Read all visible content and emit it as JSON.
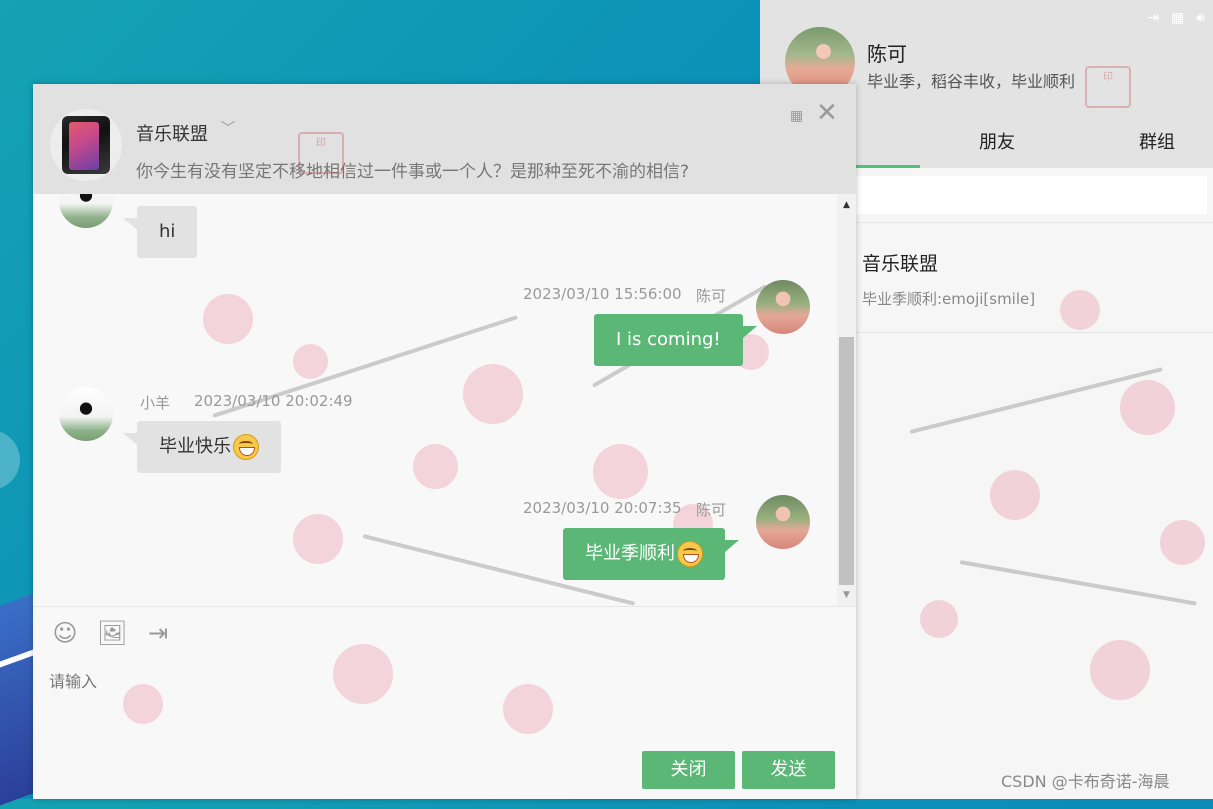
{
  "main_panel": {
    "user_name": "陈可",
    "signature": "毕业季，稻谷丰收，毕业顺利",
    "tabs": [
      {
        "label": "朋友"
      },
      {
        "label": "群组"
      }
    ],
    "conversation": {
      "name": "音乐联盟",
      "last_message": "毕业季顺利:emoji[smile]"
    }
  },
  "chat": {
    "group_name": "音乐联盟",
    "group_desc": "你今生有没有坚定不移地相信过一件事或一个人？是那种至死不渝的相信?",
    "messages": [
      {
        "direction": "in",
        "sender": "",
        "time": "",
        "text": "hi"
      },
      {
        "direction": "out",
        "sender": "陈可",
        "time": "2023/03/10 15:56:00",
        "text": "I is coming!"
      },
      {
        "direction": "in",
        "sender": "小羊",
        "time": "2023/03/10 20:02:49",
        "text": "毕业快乐",
        "emoji": "grin"
      },
      {
        "direction": "out",
        "sender": "陈可",
        "time": "2023/03/10 20:07:35",
        "text": "毕业季顺利",
        "emoji": "grin"
      }
    ],
    "input_placeholder": "请输入",
    "close_label": "关闭",
    "send_label": "发送"
  },
  "watermark": "CSDN @卡布奇诺-海晨",
  "colors": {
    "accent_green": "#5bb775",
    "tab_underline": "#4cc57a",
    "incoming_bubble": "#e2e2e2"
  },
  "icons": {
    "toolbar": [
      "emoji-icon",
      "image-icon",
      "file-icon"
    ],
    "window": [
      "qrcode-icon",
      "close-icon"
    ],
    "main_top": [
      "exit-icon",
      "qrcode-icon",
      "volume-icon"
    ]
  }
}
